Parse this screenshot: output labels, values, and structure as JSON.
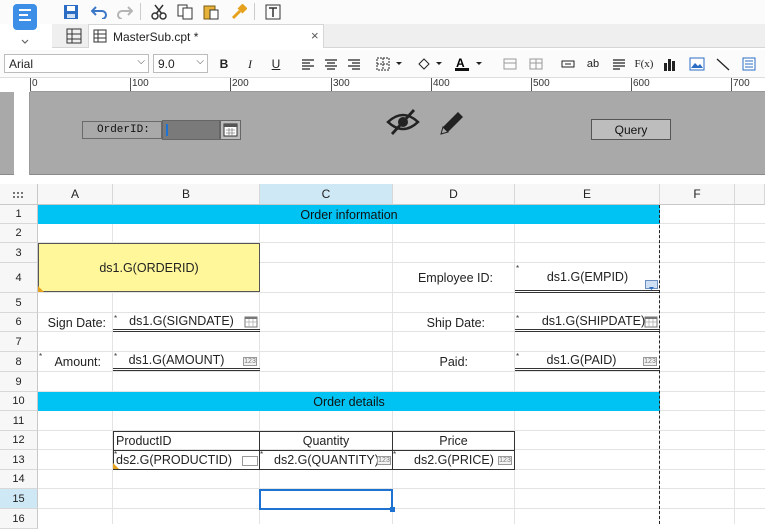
{
  "tab": {
    "label": "MasterSub.cpt *",
    "close": "×"
  },
  "format": {
    "font": "Arial",
    "size": "9.0",
    "bold": "B",
    "italic": "I",
    "underline": "U",
    "ab": "ab",
    "fx": "F(x)"
  },
  "ruler": {
    "ticks": [
      "0",
      "100",
      "200",
      "300",
      "400",
      "500",
      "600",
      "700"
    ]
  },
  "params": {
    "orderid_label": "OrderID:",
    "query": "Query"
  },
  "columns": [
    "A",
    "B",
    "C",
    "D",
    "E",
    "F"
  ],
  "rows": [
    "1",
    "2",
    "3",
    "4",
    "5",
    "6",
    "7",
    "8",
    "9",
    "10",
    "11",
    "12",
    "13",
    "14",
    "15",
    "16"
  ],
  "cells": {
    "order_info": "Order information",
    "orderid": "ds1.G(ORDERID)",
    "employee_label": "Employee ID:",
    "empid": "ds1.G(EMPID)",
    "sign_label": "Sign Date:",
    "signdate": "ds1.G(SIGNDATE)",
    "ship_label": "Ship Date:",
    "shipdate": "ds1.G(SHIPDATE)",
    "amount_label": "Amount:",
    "amount": "ds1.G(AMOUNT)",
    "paid_label": "Paid:",
    "paid": "ds1.G(PAID)",
    "order_details": "Order details",
    "productid_hdr": "ProductID",
    "quantity_hdr": "Quantity",
    "price_hdr": "Price",
    "productid": "ds2.G(PRODUCTID)",
    "quantity": "ds2.G(QUANTITY)",
    "price": "ds2.G(PRICE)"
  },
  "icons": {
    "num": "123"
  },
  "colors": {
    "accent": "#00c3f3",
    "highlight": "#fff79a",
    "selection": "#1e73d2"
  }
}
